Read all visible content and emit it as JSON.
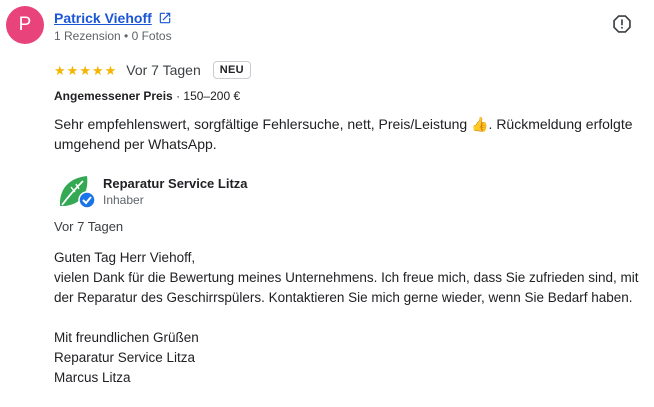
{
  "reviewer": {
    "initial": "P",
    "avatar_color": "#e8437a",
    "name": "Patrick Viehoff",
    "meta": "1 Rezension • 0 Fotos"
  },
  "review": {
    "stars": 5,
    "star_glyph": "★",
    "date": "Vor 7 Tagen",
    "badge": "NEU",
    "price_label": "Angemessener Preis",
    "price_value": " · 150–200 €",
    "text": "Sehr empfehlenswert, sorgfältige Fehlersuche, nett, Preis/Leistung 👍. Rückmeldung erfolgte umgehend per WhatsApp."
  },
  "owner": {
    "name": "Reparatur Service Litza",
    "role": "Inhaber",
    "reply_date": "Vor 7 Tagen",
    "reply_lines": [
      "Guten Tag Herr Viehoff,",
      "vielen Dank für die Bewertung meines Unternehmens. Ich freue mich, dass Sie zufrieden sind, mit der Reparatur des Geschirrspülers. Kontaktieren Sie mich gerne wieder, wenn Sie Bedarf haben."
    ],
    "closing_lines": [
      "Mit freundlichen Grüßen",
      "Reparatur Service Litza",
      "Marcus Litza"
    ]
  },
  "colors": {
    "link": "#1a56d6",
    "star": "#f5b400",
    "verified": "#1a73e8",
    "logo_green": "#34a853"
  },
  "icons": {
    "external": "external-link-icon",
    "flag": "report-flag-icon",
    "verified": "verified-check-icon"
  }
}
